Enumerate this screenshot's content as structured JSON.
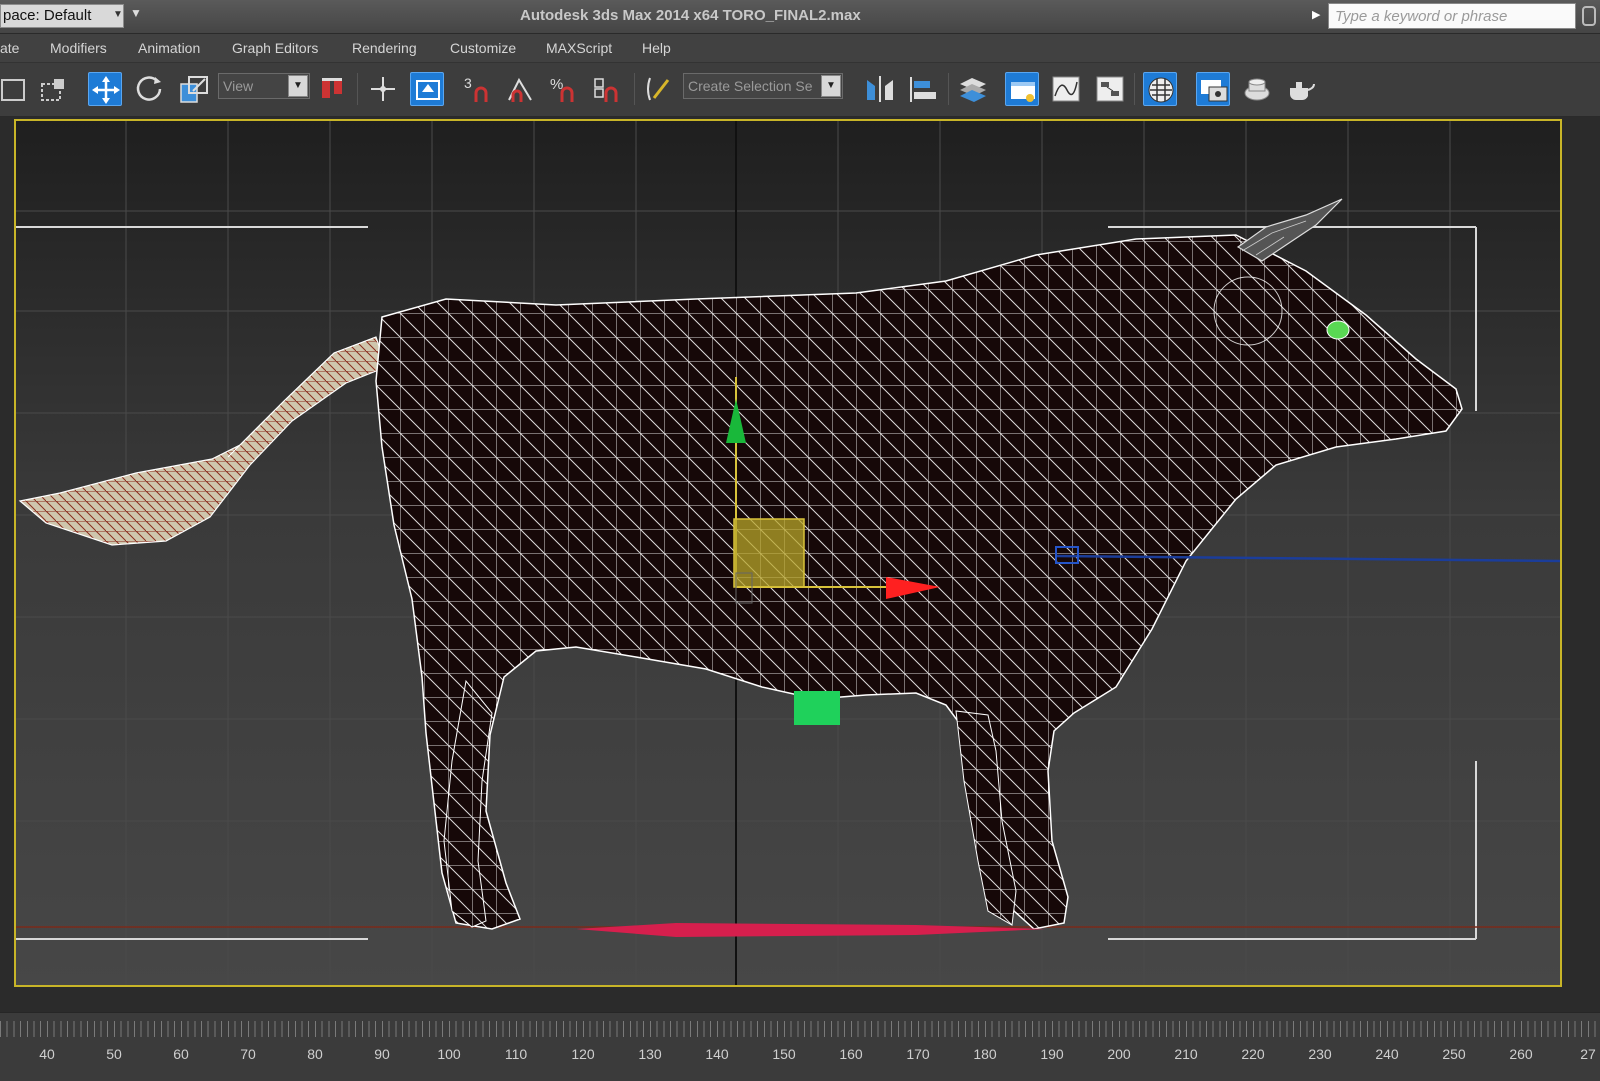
{
  "titlebar": {
    "workspace_label": "pace: Default",
    "app_title": "Autodesk 3ds Max  2014 x64      TORO_FINAL2.max",
    "search_placeholder": "Type a keyword or phrase"
  },
  "menus": [
    "ate",
    "Modifiers",
    "Animation",
    "Graph Editors",
    "Rendering",
    "Customize",
    "MAXScript",
    "Help"
  ],
  "toolbar": {
    "reference_coord_value": "View",
    "spinner_snap_label": "3",
    "percent_snap_label": "%",
    "named_selection_placeholder": "Create Selection Se",
    "icons": [
      "select-region-icon",
      "window-crossing-icon",
      "select-move-icon",
      "select-rotate-icon",
      "select-scale-icon",
      "use-pivot-icon",
      "select-manipulate-icon",
      "snaps-toggle-icon",
      "angle-snap-icon",
      "percent-snap-icon",
      "spinner-snap-icon",
      "edit-named-selection-icon",
      "mirror-icon",
      "align-icon",
      "layer-manager-icon",
      "scene-explorer-icon",
      "curve-editor-icon",
      "schematic-view-icon",
      "material-editor-icon",
      "render-setup-icon",
      "rendered-frame-window-icon",
      "render-production-icon"
    ]
  },
  "viewport": {
    "model": "bull-wireframe",
    "accent_border": "#c8b528",
    "wire_color": "#ffffff",
    "mesh_fill": "#160808",
    "axis_x_color": "#ff2020",
    "axis_y_color": "#19b83a",
    "axis_z_color": "#1b3d9a",
    "ground_line_color": "#d61f4d"
  },
  "timeline": {
    "tick_labels": [
      "40",
      "50",
      "60",
      "70",
      "80",
      "90",
      "100",
      "110",
      "120",
      "130",
      "140",
      "150",
      "160",
      "170",
      "180",
      "190",
      "200",
      "210",
      "220",
      "230",
      "240",
      "250",
      "260",
      "27"
    ]
  }
}
